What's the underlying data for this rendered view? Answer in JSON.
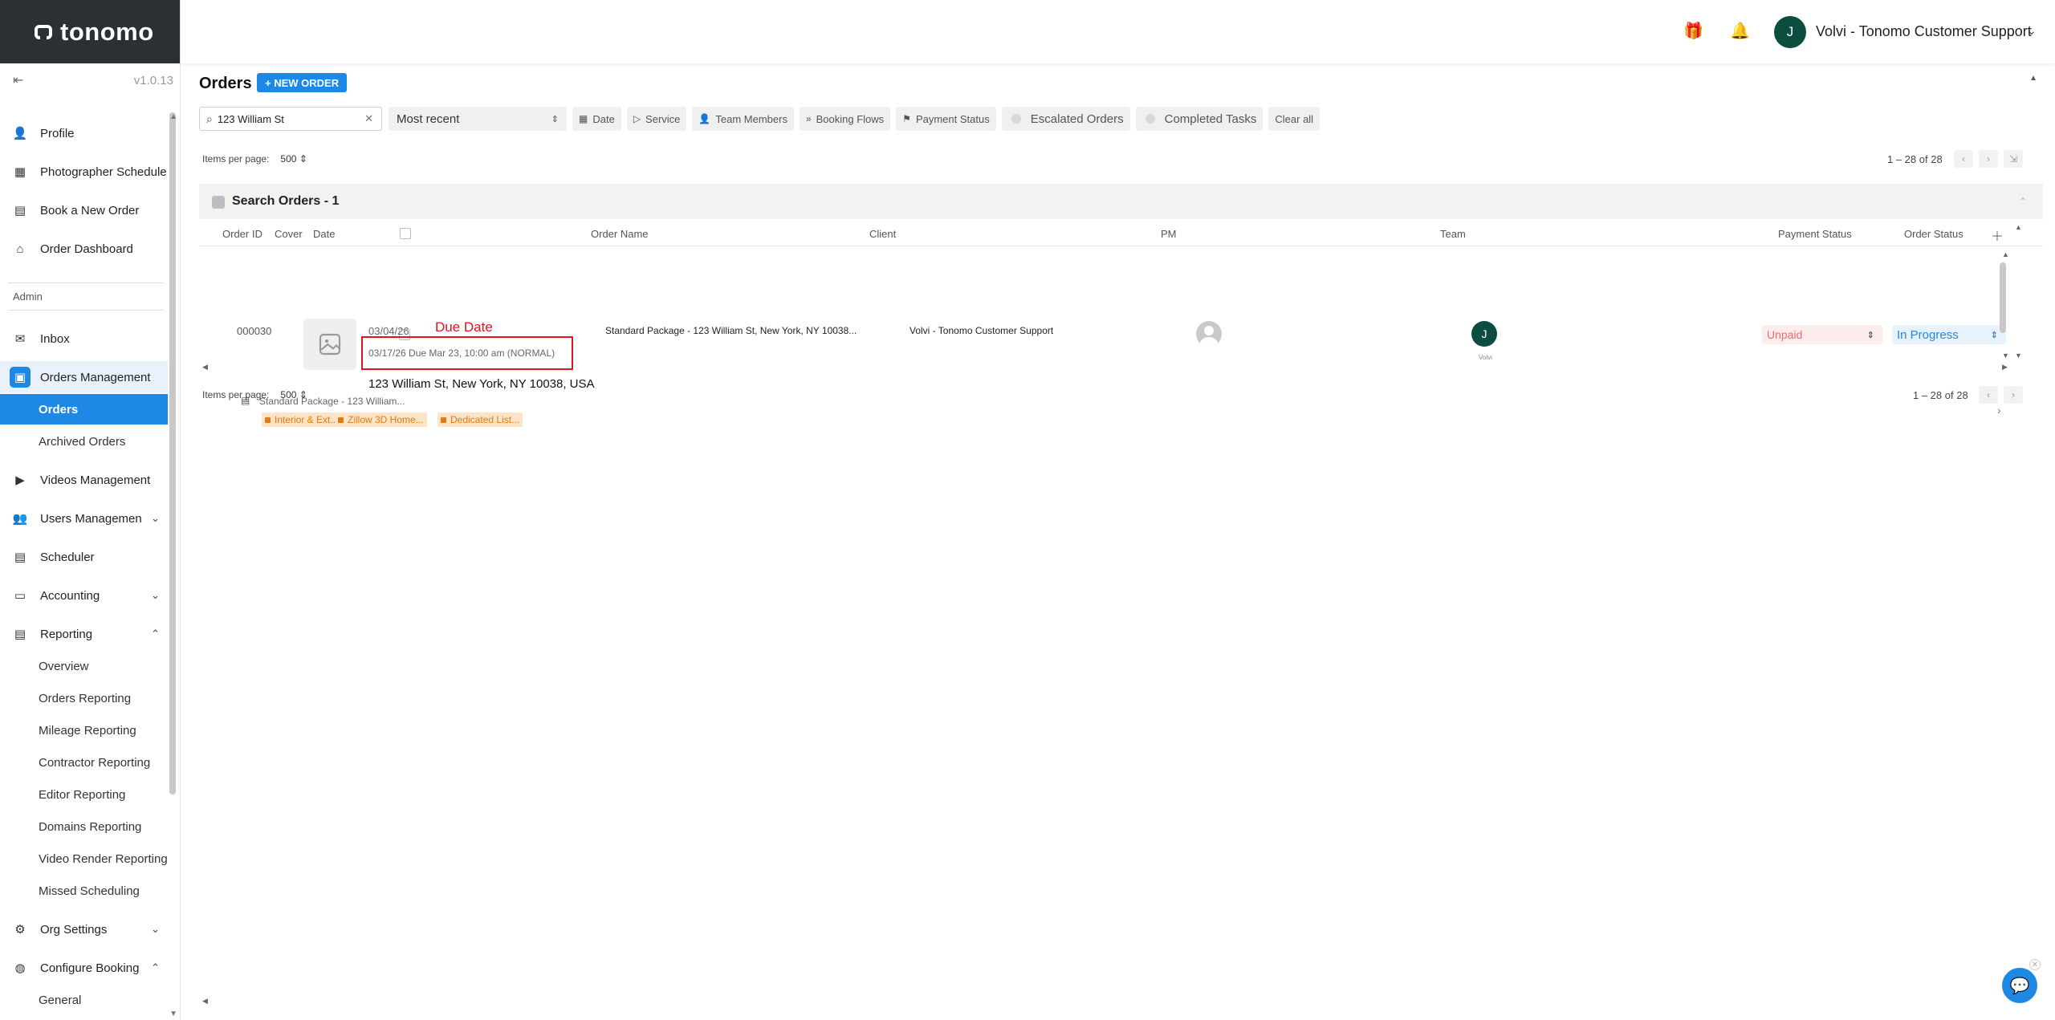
{
  "brand": {
    "name": "tonomo",
    "version": "v1.0.13"
  },
  "header": {
    "avatar_initial": "J",
    "user_name": "Volvi - Tonomo Customer Support"
  },
  "sidebar": {
    "items": [
      {
        "label": "Profile"
      },
      {
        "label": "Photographer Schedule"
      },
      {
        "label": "Book a New Order"
      },
      {
        "label": "Order Dashboard"
      }
    ],
    "admin_label": "Admin",
    "admin_items": [
      {
        "label": "Inbox"
      },
      {
        "label": "Orders Management"
      },
      {
        "label": "Videos Management"
      },
      {
        "label": "Users Managemen"
      },
      {
        "label": "Scheduler"
      },
      {
        "label": "Accounting"
      },
      {
        "label": "Reporting"
      },
      {
        "label": "Org Settings"
      },
      {
        "label": "Configure Booking"
      }
    ],
    "orders_sub": [
      "Orders",
      "Archived Orders"
    ],
    "reporting_sub": [
      "Overview",
      "Orders Reporting",
      "Mileage Reporting",
      "Contractor Reporting",
      "Editor Reporting",
      "Domains Reporting",
      "Video Render Reporting",
      "Missed Scheduling"
    ],
    "booking_sub": [
      "General"
    ]
  },
  "page": {
    "title": "Orders",
    "new_order_label": "+ NEW ORDER",
    "search_value": "123 William St",
    "sort_value": "Most recent",
    "filters": [
      "Date",
      "Service",
      "Team Members",
      "Booking Flows",
      "Payment Status"
    ],
    "toggle_filters": [
      "Escalated Orders",
      "Completed Tasks"
    ],
    "clear_all": "Clear all",
    "items_per_page_label": "Items per page:",
    "items_per_page_value": "500",
    "range_text": "1 – 28 of 28"
  },
  "group": {
    "title": "Search Orders - 1"
  },
  "table": {
    "columns": [
      "Order ID",
      "Cover",
      "Date",
      "Order Name",
      "Client",
      "PM",
      "Team",
      "Payment Status",
      "Order Status"
    ],
    "rows": [
      {
        "order_id": "000030",
        "date": "03/04/26",
        "due": "03/17/26 Due Mar 23, 10:00 am (NORMAL)",
        "address": "123 William St, New York, NY 10038, USA",
        "order_name": "Standard Package - 123 William St, New York, NY 10038...",
        "client": "Volvi - Tonomo Customer Support",
        "team_initial": "J",
        "team_name": "Volvi",
        "payment_status": "Unpaid",
        "order_status": "In Progress",
        "package_line": "Standard Package - 123 William...",
        "tags": [
          "Interior & Ext...",
          "Zillow 3D Home...",
          "Dedicated List..."
        ]
      }
    ]
  },
  "annotation": {
    "label": "Due Date",
    "color": "#e0141e"
  },
  "colors": {
    "accent": "#1e88e5",
    "sidebar_dark": "#2b3035",
    "avatar": "#0b4d3e",
    "unpaid": "#ef6b6b",
    "tag": "#e07a12"
  }
}
